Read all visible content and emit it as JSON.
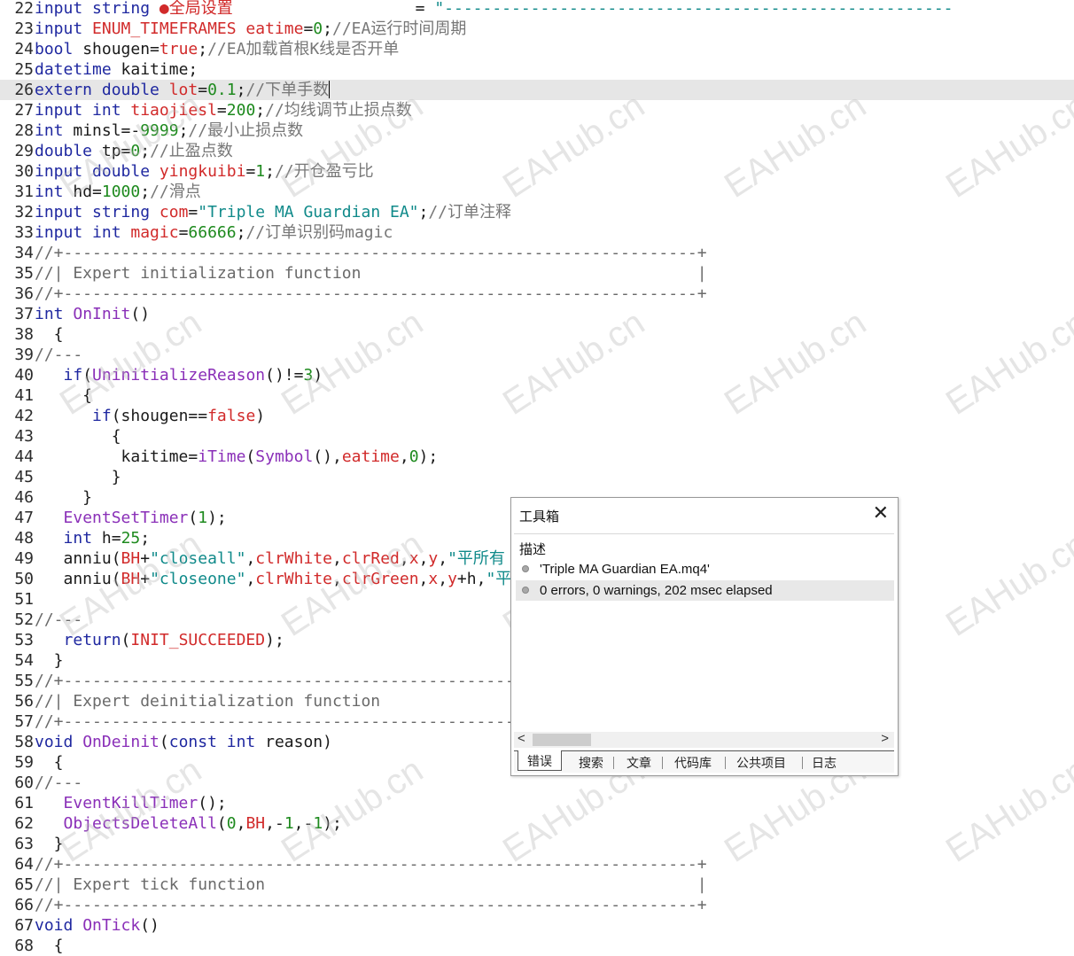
{
  "editor": {
    "current_line": "26",
    "lines": [
      {
        "num": "22",
        "segs": [
          {
            "c": "kw",
            "t": "input string "
          },
          {
            "c": "red",
            "t": "●全局设置"
          },
          {
            "c": "",
            "t": "                   = "
          },
          {
            "c": "str",
            "t": "\"-----------------------------------------------------"
          }
        ]
      },
      {
        "num": "23",
        "segs": [
          {
            "c": "kw",
            "t": "input "
          },
          {
            "c": "red",
            "t": "ENUM_TIMEFRAMES eatime"
          },
          {
            "c": "",
            "t": "="
          },
          {
            "c": "grn",
            "t": "0"
          },
          {
            "c": "",
            "t": ";"
          },
          {
            "c": "cm",
            "t": "//EA运行时间周期"
          }
        ]
      },
      {
        "num": "24",
        "segs": [
          {
            "c": "kw",
            "t": "bool "
          },
          {
            "c": "",
            "t": "shougen="
          },
          {
            "c": "red",
            "t": "true"
          },
          {
            "c": "",
            "t": ";"
          },
          {
            "c": "cm",
            "t": "//EA加载首根K线是否开单"
          }
        ]
      },
      {
        "num": "25",
        "segs": [
          {
            "c": "kw",
            "t": "datetime "
          },
          {
            "c": "",
            "t": "kaitime;"
          }
        ]
      },
      {
        "num": "26",
        "segs": [
          {
            "c": "kw",
            "t": "extern double "
          },
          {
            "c": "red",
            "t": "lot"
          },
          {
            "c": "",
            "t": "="
          },
          {
            "c": "grn",
            "t": "0.1"
          },
          {
            "c": "",
            "t": ";"
          },
          {
            "c": "cm",
            "t": "//下单手数"
          }
        ]
      },
      {
        "num": "27",
        "segs": [
          {
            "c": "kw",
            "t": "input int "
          },
          {
            "c": "red",
            "t": "tiaojiesl"
          },
          {
            "c": "",
            "t": "="
          },
          {
            "c": "grn",
            "t": "200"
          },
          {
            "c": "",
            "t": ";"
          },
          {
            "c": "cm",
            "t": "//均线调节止损点数"
          }
        ]
      },
      {
        "num": "28",
        "segs": [
          {
            "c": "kw",
            "t": "int "
          },
          {
            "c": "",
            "t": "minsl=-"
          },
          {
            "c": "grn",
            "t": "9999"
          },
          {
            "c": "",
            "t": ";"
          },
          {
            "c": "cm",
            "t": "//最小止损点数"
          }
        ]
      },
      {
        "num": "29",
        "segs": [
          {
            "c": "kw",
            "t": "double "
          },
          {
            "c": "",
            "t": "tp="
          },
          {
            "c": "grn",
            "t": "0"
          },
          {
            "c": "",
            "t": ";"
          },
          {
            "c": "cm",
            "t": "//止盈点数"
          }
        ]
      },
      {
        "num": "30",
        "segs": [
          {
            "c": "kw",
            "t": "input double "
          },
          {
            "c": "red",
            "t": "yingkuibi"
          },
          {
            "c": "",
            "t": "="
          },
          {
            "c": "grn",
            "t": "1"
          },
          {
            "c": "",
            "t": ";"
          },
          {
            "c": "cm",
            "t": "//开仓盈亏比"
          }
        ]
      },
      {
        "num": "31",
        "segs": [
          {
            "c": "kw",
            "t": "int "
          },
          {
            "c": "",
            "t": "hd="
          },
          {
            "c": "grn",
            "t": "1000"
          },
          {
            "c": "",
            "t": ";"
          },
          {
            "c": "cm",
            "t": "//滑点"
          }
        ]
      },
      {
        "num": "32",
        "segs": [
          {
            "c": "kw",
            "t": "input string "
          },
          {
            "c": "red",
            "t": "com"
          },
          {
            "c": "",
            "t": "="
          },
          {
            "c": "str",
            "t": "\"Triple MA Guardian EA\""
          },
          {
            "c": "",
            "t": ";"
          },
          {
            "c": "cm",
            "t": "//订单注释"
          }
        ]
      },
      {
        "num": "33",
        "segs": [
          {
            "c": "kw",
            "t": "input int "
          },
          {
            "c": "red",
            "t": "magic"
          },
          {
            "c": "",
            "t": "="
          },
          {
            "c": "grn",
            "t": "66666"
          },
          {
            "c": "",
            "t": ";"
          },
          {
            "c": "cm",
            "t": "//订单识别码magic"
          }
        ]
      },
      {
        "num": "34",
        "segs": [
          {
            "c": "cmd",
            "t": "//+------------------------------------------------------------------+"
          }
        ]
      },
      {
        "num": "35",
        "segs": [
          {
            "c": "cmd",
            "t": "//| Expert initialization function                                   |"
          }
        ]
      },
      {
        "num": "36",
        "segs": [
          {
            "c": "cmd",
            "t": "//+------------------------------------------------------------------+"
          }
        ]
      },
      {
        "num": "37",
        "segs": [
          {
            "c": "kw",
            "t": "int "
          },
          {
            "c": "fn",
            "t": "OnInit"
          },
          {
            "c": "",
            "t": "()"
          }
        ]
      },
      {
        "num": "38",
        "segs": [
          {
            "c": "",
            "t": "  {"
          }
        ]
      },
      {
        "num": "39",
        "segs": [
          {
            "c": "cmd",
            "t": "//---"
          }
        ]
      },
      {
        "num": "40",
        "segs": [
          {
            "c": "",
            "t": "   "
          },
          {
            "c": "kw",
            "t": "if"
          },
          {
            "c": "",
            "t": "("
          },
          {
            "c": "fn",
            "t": "UninitializeReason"
          },
          {
            "c": "",
            "t": "()!="
          },
          {
            "c": "grn",
            "t": "3"
          },
          {
            "c": "",
            "t": ")"
          }
        ]
      },
      {
        "num": "41",
        "segs": [
          {
            "c": "",
            "t": "     {"
          }
        ]
      },
      {
        "num": "42",
        "segs": [
          {
            "c": "",
            "t": "      "
          },
          {
            "c": "kw",
            "t": "if"
          },
          {
            "c": "",
            "t": "(shougen=="
          },
          {
            "c": "red",
            "t": "false"
          },
          {
            "c": "",
            "t": ")"
          }
        ]
      },
      {
        "num": "43",
        "segs": [
          {
            "c": "",
            "t": "        {"
          }
        ]
      },
      {
        "num": "44",
        "segs": [
          {
            "c": "",
            "t": "         kaitime="
          },
          {
            "c": "fn",
            "t": "iTime"
          },
          {
            "c": "",
            "t": "("
          },
          {
            "c": "fn",
            "t": "Symbol"
          },
          {
            "c": "",
            "t": "(),"
          },
          {
            "c": "red",
            "t": "eatime"
          },
          {
            "c": "",
            "t": ","
          },
          {
            "c": "grn",
            "t": "0"
          },
          {
            "c": "",
            "t": ");"
          }
        ]
      },
      {
        "num": "45",
        "segs": [
          {
            "c": "",
            "t": "        }"
          }
        ]
      },
      {
        "num": "46",
        "segs": [
          {
            "c": "",
            "t": "     }"
          }
        ]
      },
      {
        "num": "47",
        "segs": [
          {
            "c": "",
            "t": "   "
          },
          {
            "c": "fn",
            "t": "EventSetTimer"
          },
          {
            "c": "",
            "t": "("
          },
          {
            "c": "grn",
            "t": "1"
          },
          {
            "c": "",
            "t": ");"
          }
        ]
      },
      {
        "num": "48",
        "segs": [
          {
            "c": "",
            "t": "   "
          },
          {
            "c": "kw",
            "t": "int "
          },
          {
            "c": "",
            "t": "h="
          },
          {
            "c": "grn",
            "t": "25"
          },
          {
            "c": "",
            "t": ";"
          }
        ]
      },
      {
        "num": "49",
        "segs": [
          {
            "c": "",
            "t": "   anniu("
          },
          {
            "c": "red",
            "t": "BH"
          },
          {
            "c": "",
            "t": "+"
          },
          {
            "c": "str",
            "t": "\"closeall\""
          },
          {
            "c": "",
            "t": ","
          },
          {
            "c": "red",
            "t": "clrWhite"
          },
          {
            "c": "",
            "t": ","
          },
          {
            "c": "red",
            "t": "clrRed"
          },
          {
            "c": "",
            "t": ","
          },
          {
            "c": "red",
            "t": "x"
          },
          {
            "c": "",
            "t": ","
          },
          {
            "c": "red",
            "t": "y"
          },
          {
            "c": "",
            "t": ","
          },
          {
            "c": "str",
            "t": "\"平所有"
          }
        ]
      },
      {
        "num": "50",
        "segs": [
          {
            "c": "",
            "t": "   anniu("
          },
          {
            "c": "red",
            "t": "BH"
          },
          {
            "c": "",
            "t": "+"
          },
          {
            "c": "str",
            "t": "\"closeone\""
          },
          {
            "c": "",
            "t": ","
          },
          {
            "c": "red",
            "t": "clrWhite"
          },
          {
            "c": "",
            "t": ","
          },
          {
            "c": "red",
            "t": "clrGreen"
          },
          {
            "c": "",
            "t": ","
          },
          {
            "c": "red",
            "t": "x"
          },
          {
            "c": "",
            "t": ","
          },
          {
            "c": "red",
            "t": "y"
          },
          {
            "c": "",
            "t": "+h,"
          },
          {
            "c": "str",
            "t": "\"平"
          }
        ]
      },
      {
        "num": "51",
        "segs": []
      },
      {
        "num": "52",
        "segs": [
          {
            "c": "cmd",
            "t": "//---"
          }
        ]
      },
      {
        "num": "53",
        "segs": [
          {
            "c": "",
            "t": "   "
          },
          {
            "c": "kw",
            "t": "return"
          },
          {
            "c": "",
            "t": "("
          },
          {
            "c": "red",
            "t": "INIT_SUCCEEDED"
          },
          {
            "c": "",
            "t": ");"
          }
        ]
      },
      {
        "num": "54",
        "segs": [
          {
            "c": "",
            "t": "  }"
          }
        ]
      },
      {
        "num": "55",
        "segs": [
          {
            "c": "cmd",
            "t": "//+------------------------------------------------------------------+"
          }
        ]
      },
      {
        "num": "56",
        "segs": [
          {
            "c": "cmd",
            "t": "//| Expert deinitialization function                                 |"
          }
        ]
      },
      {
        "num": "57",
        "segs": [
          {
            "c": "cmd",
            "t": "//+------------------------------------------------------------------+"
          }
        ]
      },
      {
        "num": "58",
        "segs": [
          {
            "c": "kw",
            "t": "void "
          },
          {
            "c": "fn",
            "t": "OnDeinit"
          },
          {
            "c": "",
            "t": "("
          },
          {
            "c": "kw",
            "t": "const int "
          },
          {
            "c": "",
            "t": "reason)"
          }
        ]
      },
      {
        "num": "59",
        "segs": [
          {
            "c": "",
            "t": "  {"
          }
        ]
      },
      {
        "num": "60",
        "segs": [
          {
            "c": "cmd",
            "t": "//---"
          }
        ]
      },
      {
        "num": "61",
        "segs": [
          {
            "c": "",
            "t": "   "
          },
          {
            "c": "fn",
            "t": "EventKillTimer"
          },
          {
            "c": "",
            "t": "();"
          }
        ]
      },
      {
        "num": "62",
        "segs": [
          {
            "c": "",
            "t": "   "
          },
          {
            "c": "fn",
            "t": "ObjectsDeleteAll"
          },
          {
            "c": "",
            "t": "("
          },
          {
            "c": "grn",
            "t": "0"
          },
          {
            "c": "",
            "t": ","
          },
          {
            "c": "red",
            "t": "BH"
          },
          {
            "c": "",
            "t": ",-"
          },
          {
            "c": "grn",
            "t": "1"
          },
          {
            "c": "",
            "t": ",-"
          },
          {
            "c": "grn",
            "t": "1"
          },
          {
            "c": "",
            "t": ");"
          }
        ]
      },
      {
        "num": "63",
        "segs": [
          {
            "c": "",
            "t": "  }"
          }
        ]
      },
      {
        "num": "64",
        "segs": [
          {
            "c": "cmd",
            "t": "//+------------------------------------------------------------------+"
          }
        ]
      },
      {
        "num": "65",
        "segs": [
          {
            "c": "cmd",
            "t": "//| Expert tick function                                             |"
          }
        ]
      },
      {
        "num": "66",
        "segs": [
          {
            "c": "cmd",
            "t": "//+------------------------------------------------------------------+"
          }
        ]
      },
      {
        "num": "67",
        "segs": [
          {
            "c": "kw",
            "t": "void "
          },
          {
            "c": "fn",
            "t": "OnTick"
          },
          {
            "c": "",
            "t": "()"
          }
        ]
      },
      {
        "num": "68",
        "segs": [
          {
            "c": "",
            "t": "  {"
          }
        ]
      }
    ]
  },
  "watermark": {
    "text": "EAHub.cn"
  },
  "toolbox": {
    "title": "工具箱",
    "column_header": "描述",
    "messages": [
      {
        "text": "'Triple MA Guardian EA.mq4'",
        "selected": false
      },
      {
        "text": "0 errors, 0 warnings, 202 msec elapsed",
        "selected": true
      }
    ],
    "tabs": [
      {
        "label": "错误",
        "active": true
      },
      {
        "label": "搜索",
        "active": false
      },
      {
        "label": "文章",
        "active": false
      },
      {
        "label": "代码库",
        "active": false
      },
      {
        "label": "公共项目",
        "active": false
      },
      {
        "label": "日志",
        "active": false
      }
    ]
  },
  "colors": {
    "keyword": "#1f28a0",
    "identifier_red": "#d12a2a",
    "number": "#1e8a1e",
    "function": "#8a2fb8",
    "string": "#108a8a",
    "comment": "#777777",
    "current_line_bg": "#e6e6e6"
  }
}
